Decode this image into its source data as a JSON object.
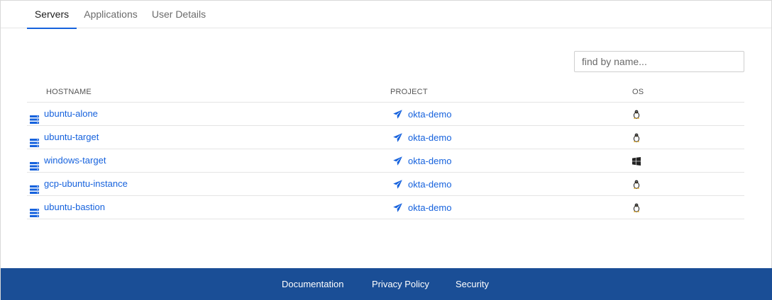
{
  "tabs": [
    {
      "label": "Servers",
      "active": true
    },
    {
      "label": "Applications",
      "active": false
    },
    {
      "label": "User Details",
      "active": false
    }
  ],
  "search": {
    "placeholder": "find by name...",
    "value": ""
  },
  "table": {
    "headers": {
      "hostname": "HOSTNAME",
      "project": "PROJECT",
      "os": "OS"
    },
    "rows": [
      {
        "hostname": "ubuntu-alone",
        "project": "okta-demo",
        "os": "linux-icon"
      },
      {
        "hostname": "ubuntu-target",
        "project": "okta-demo",
        "os": "linux-icon"
      },
      {
        "hostname": "windows-target",
        "project": "okta-demo",
        "os": "windows-icon"
      },
      {
        "hostname": "gcp-ubuntu-instance",
        "project": "okta-demo",
        "os": "linux-icon"
      },
      {
        "hostname": "ubuntu-bastion",
        "project": "okta-demo",
        "os": "linux-icon"
      }
    ]
  },
  "footer": {
    "links": [
      "Documentation",
      "Privacy Policy",
      "Security"
    ]
  },
  "colors": {
    "accent": "#1662dd",
    "footer_bg": "#1a4e96"
  }
}
